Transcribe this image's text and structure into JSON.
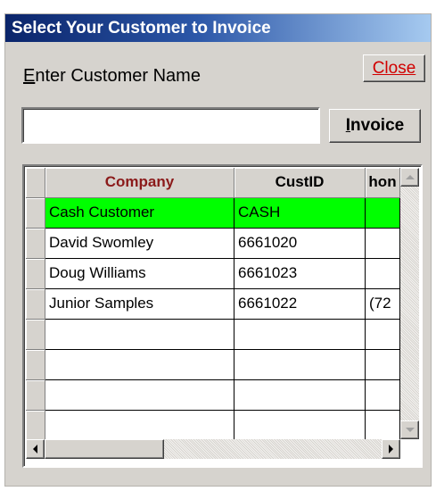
{
  "window": {
    "title": "Select Your Customer to Invoice",
    "prompt_mnemonic": "E",
    "prompt_rest": "nter Customer Name",
    "close_label": "Close",
    "invoice_mnemonic": "I",
    "invoice_rest": "nvoice",
    "name_input_value": ""
  },
  "grid": {
    "columns": [
      "Company",
      "CustID",
      "hon"
    ],
    "rows": [
      {
        "company": "Cash Customer",
        "custid": "CASH",
        "phone": "",
        "highlight": true
      },
      {
        "company": "David Swomley",
        "custid": "6661020",
        "phone": ""
      },
      {
        "company": "Doug Williams",
        "custid": "6661023",
        "phone": ""
      },
      {
        "company": "Junior Samples",
        "custid": "6661022",
        "phone": "(72"
      },
      {
        "company": "",
        "custid": "",
        "phone": ""
      },
      {
        "company": "",
        "custid": "",
        "phone": ""
      },
      {
        "company": "",
        "custid": "",
        "phone": ""
      },
      {
        "company": "",
        "custid": "",
        "phone": ""
      }
    ],
    "highlight_color": "#00ff00"
  },
  "icons": {
    "scroll_up": "arrow-up-icon",
    "scroll_down": "arrow-down-icon",
    "scroll_left": "arrow-left-icon",
    "scroll_right": "arrow-right-icon"
  }
}
